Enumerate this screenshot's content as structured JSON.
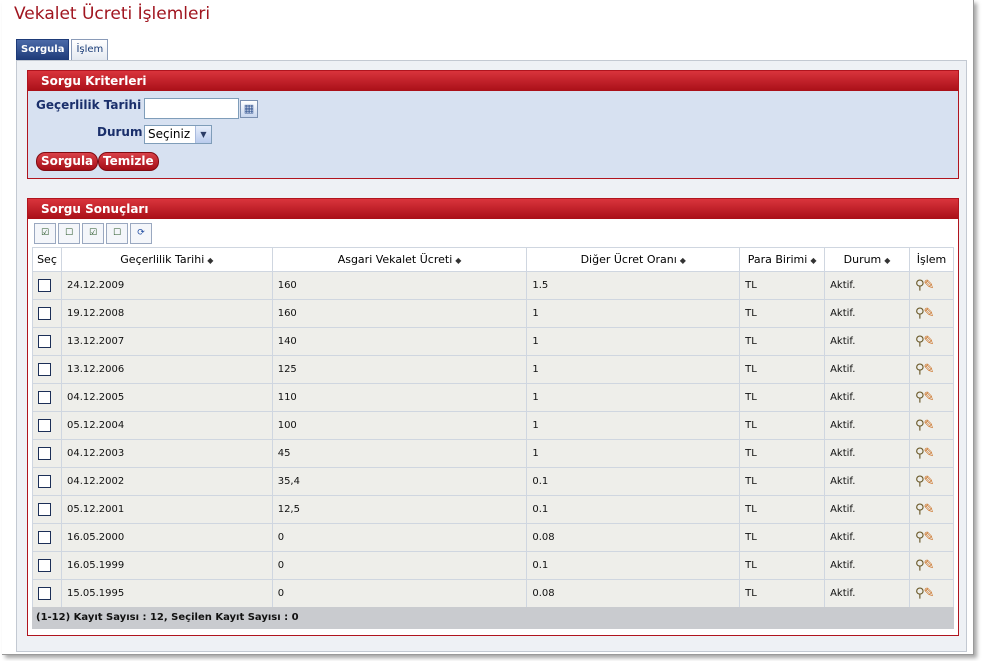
{
  "page": {
    "title": "Vekalet Ücreti İşlemleri"
  },
  "tabs": [
    {
      "label": "Sorgula"
    },
    {
      "label": "İşlem"
    }
  ],
  "criteria": {
    "header": "Sorgu Kriterleri",
    "date_label": "Geçerlilik Tarihi",
    "date_value": "",
    "status_label": "Durum",
    "status_selected": "Seçiniz",
    "query_button": "Sorgula",
    "clear_button": "Temizle"
  },
  "results": {
    "header": "Sorgu Sonuçları",
    "columns": [
      "Seç",
      "Geçerlilik Tarihi",
      "Asgari Vekalet Ücreti",
      "Diğer Ücret Oranı",
      "Para Birimi",
      "Durum",
      "İşlem"
    ],
    "rows": [
      [
        "24.12.2009",
        "160",
        "1.5",
        "TL",
        "Aktif."
      ],
      [
        "19.12.2008",
        "160",
        "1",
        "TL",
        "Aktif."
      ],
      [
        "13.12.2007",
        "140",
        "1",
        "TL",
        "Aktif."
      ],
      [
        "13.12.2006",
        "125",
        "1",
        "TL",
        "Aktif."
      ],
      [
        "04.12.2005",
        "110",
        "1",
        "TL",
        "Aktif."
      ],
      [
        "05.12.2004",
        "100",
        "1",
        "TL",
        "Aktif."
      ],
      [
        "04.12.2003",
        "45",
        "1",
        "TL",
        "Aktif."
      ],
      [
        "04.12.2002",
        "35,4",
        "0.1",
        "TL",
        "Aktif."
      ],
      [
        "05.12.2001",
        "12,5",
        "0.1",
        "TL",
        "Aktif."
      ],
      [
        "16.05.2000",
        "0",
        "0.08",
        "TL",
        "Aktif."
      ],
      [
        "16.05.1999",
        "0",
        "0.1",
        "TL",
        "Aktif."
      ],
      [
        "15.05.1995",
        "0",
        "0.08",
        "TL",
        "Aktif."
      ]
    ],
    "footer": "(1-12) Kayıt Sayısı : 12, Seçilen Kayıt Sayısı : 0"
  },
  "toolbar_icons": [
    "select-all-icon",
    "deselect-all-icon",
    "invert-selection-icon",
    "select-page-icon",
    "refresh-icon"
  ],
  "colors": {
    "accent": "#a90f18",
    "title": "#a0151f",
    "tab_active": "#1d3a78"
  }
}
